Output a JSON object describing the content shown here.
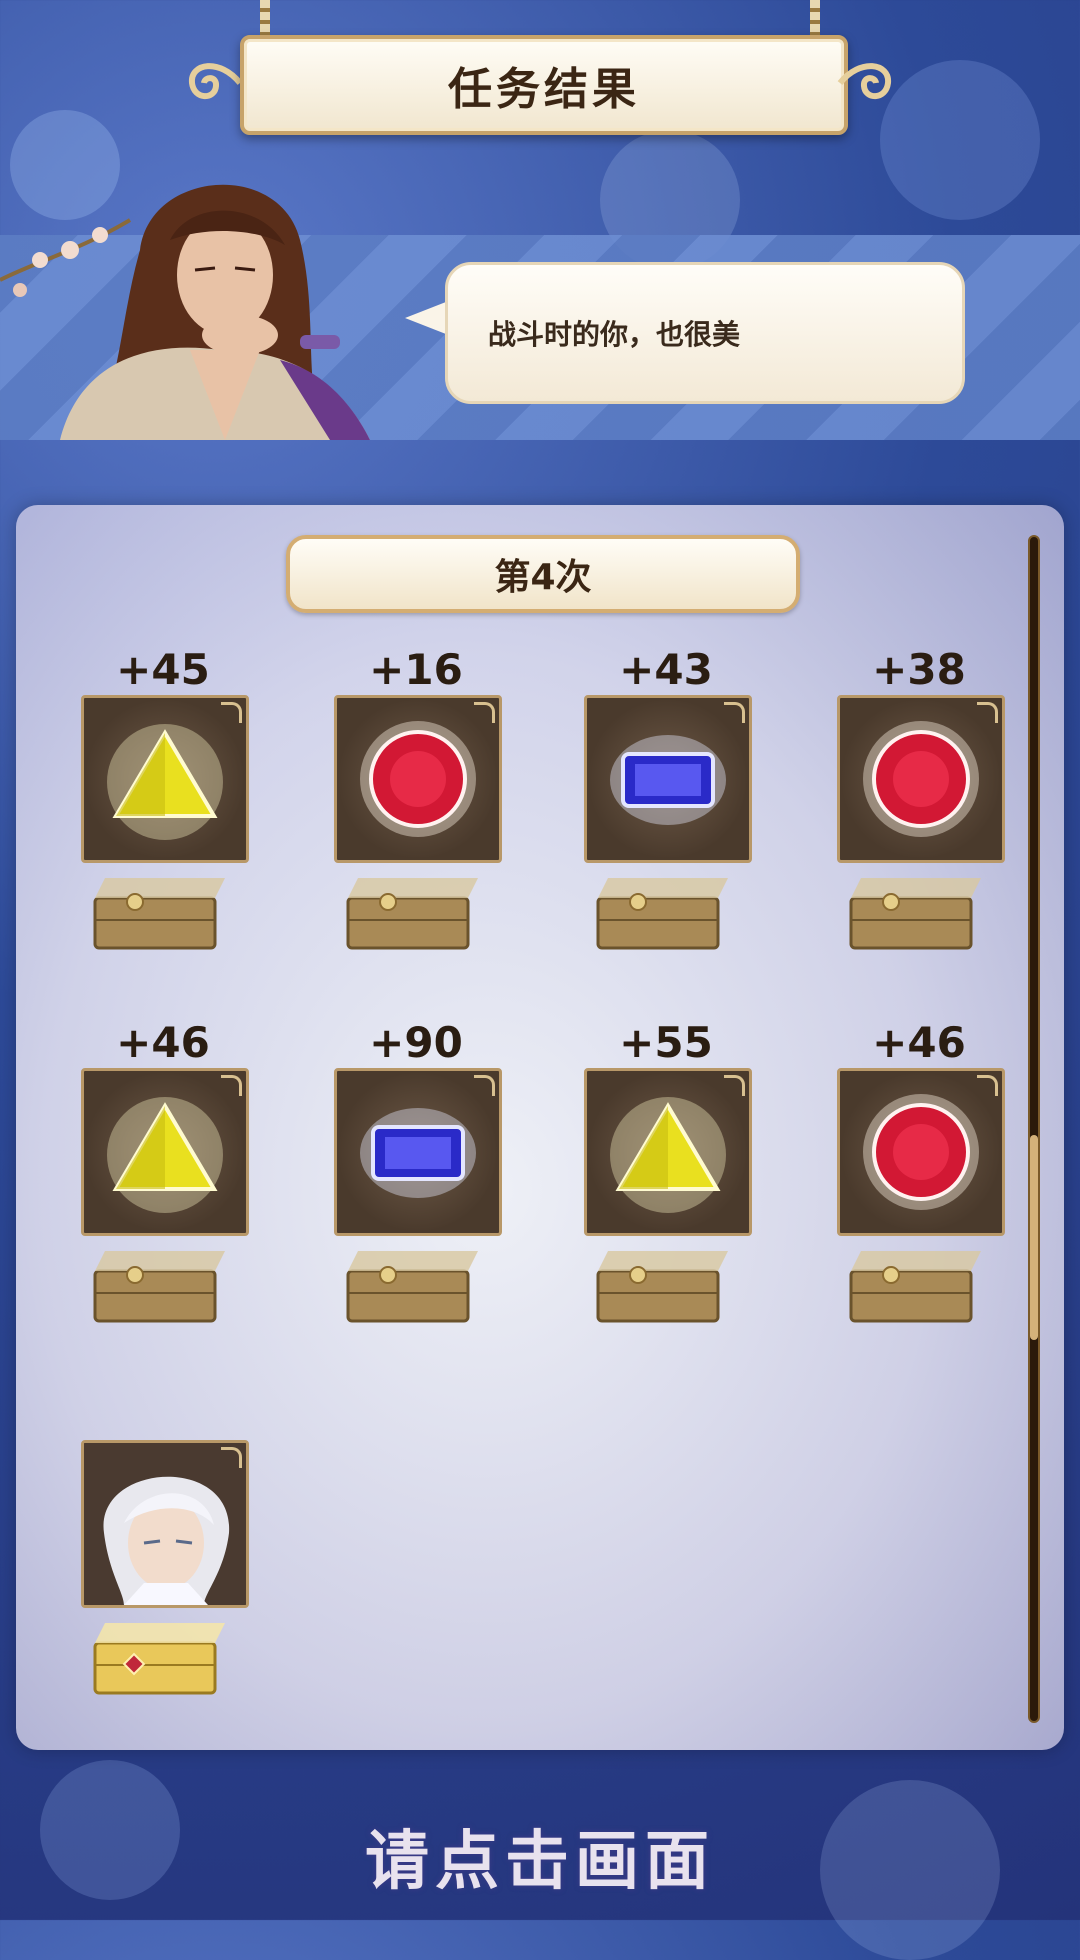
{
  "header": {
    "title": "任务结果"
  },
  "dialogue": {
    "text": "战斗时的你，也很美"
  },
  "results": {
    "round_label": "第4次",
    "items": [
      {
        "amount": "+45",
        "gem": "yellow-triangle-gem-icon"
      },
      {
        "amount": "+16",
        "gem": "red-round-gem-icon"
      },
      {
        "amount": "+43",
        "gem": "blue-rect-gem-icon"
      },
      {
        "amount": "+38",
        "gem": "red-round-gem-icon"
      },
      {
        "amount": "+46",
        "gem": "yellow-triangle-gem-icon"
      },
      {
        "amount": "+90",
        "gem": "blue-rect-gem-icon"
      },
      {
        "amount": "+55",
        "gem": "yellow-triangle-gem-icon"
      },
      {
        "amount": "+46",
        "gem": "red-round-gem-icon"
      }
    ],
    "special_reward": {
      "type": "character-card",
      "chest": "gold-chest-icon"
    }
  },
  "footer": {
    "prompt": "请点击画面"
  },
  "colors": {
    "gold": "#c7a36a",
    "panel_dark": "#4a3a2c",
    "bg_blue": "#2d4a98"
  }
}
